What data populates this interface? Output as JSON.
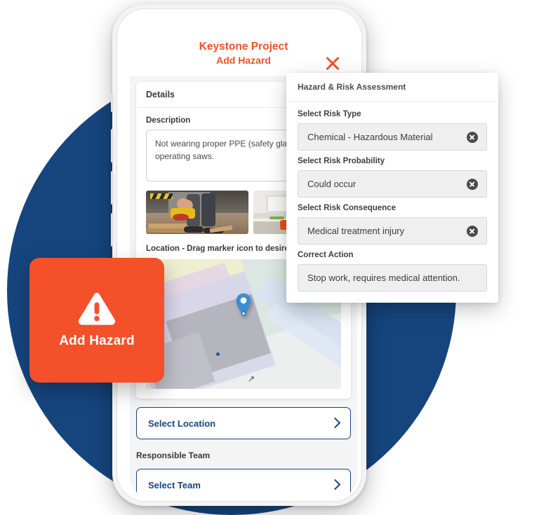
{
  "colors": {
    "brand_orange": "#F4502A",
    "brand_navy": "#16457E",
    "panel_bg": "#FFFFFF",
    "field_bg": "#EFEFEF"
  },
  "phone_app": {
    "header": {
      "title": "Keystone Project",
      "subtitle": "Add Hazard",
      "close_label": "close-icon"
    },
    "details_card": {
      "heading": "Details",
      "description_label": "Description",
      "description_value": "Not wearing proper PPE (safety glasses) while operating saws.",
      "photos": [
        {
          "alt": "Worker using circular saw on timber"
        },
        {
          "alt": "Worker at kitchen bench with tools"
        },
        {
          "alt": "Third attachment thumbnail"
        }
      ],
      "location_label": "Location - Drag marker icon to desired location",
      "map": {
        "marker_label": "map-pin"
      }
    },
    "select_location_button": "Select Location",
    "responsible_team_label": "Responsible Team",
    "select_team_button": "Select Team"
  },
  "hazard_card": {
    "label": "Add Hazard",
    "icon": "warning-triangle-icon"
  },
  "risk_panel": {
    "heading": "Hazard & Risk Assessment",
    "fields": [
      {
        "label": "Select Risk Type",
        "value": "Chemical - Hazardous Material",
        "clearable": true
      },
      {
        "label": "Select Risk Probability",
        "value": "Could occur",
        "clearable": true
      },
      {
        "label": "Select Risk Consequence",
        "value": "Medical treatment injury",
        "clearable": true
      },
      {
        "label": "Correct Action",
        "value": "Stop work, requires medical attention.",
        "clearable": false
      }
    ]
  }
}
